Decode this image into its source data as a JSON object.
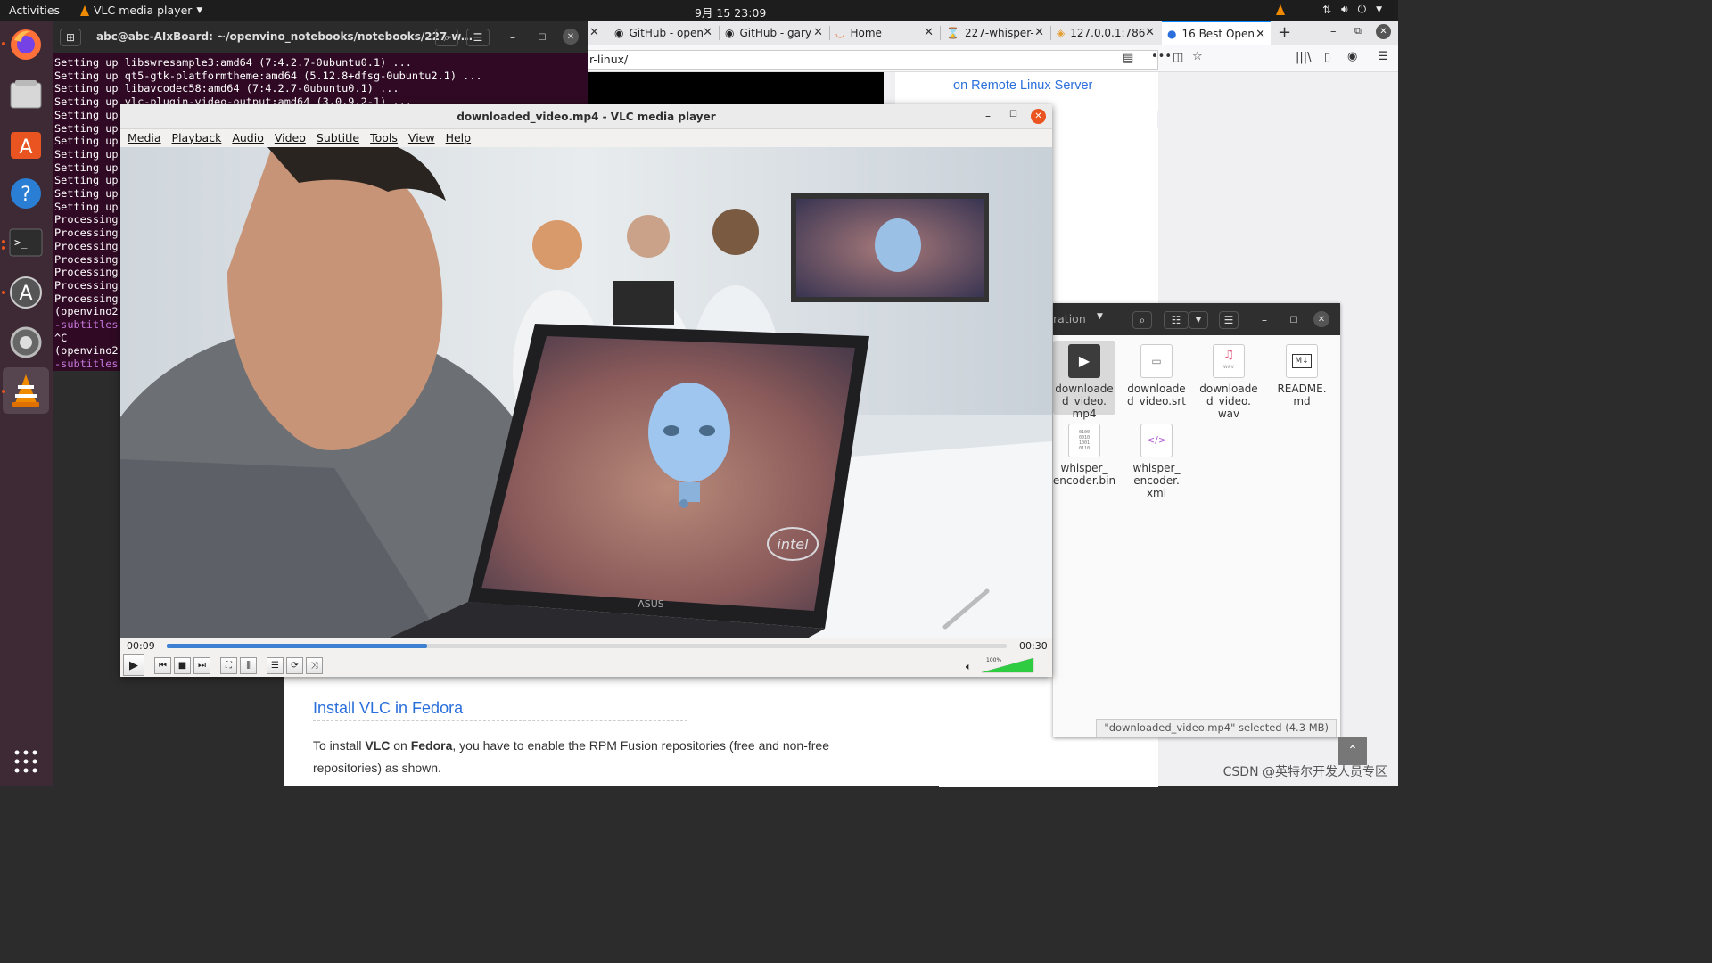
{
  "topbar": {
    "activities": "Activities",
    "app_name": "VLC media player",
    "clock": "9月 15  23:09"
  },
  "dock": {
    "items": [
      "firefox-icon",
      "files-icon",
      "software-center-icon",
      "help-icon",
      "terminal-icon",
      "software-updater-icon",
      "settings-icon",
      "vlc-icon"
    ],
    "grid_label": "show-applications-icon"
  },
  "terminal": {
    "title": "abc@abc-AIxBoard: ~/openvino_notebooks/notebooks/227-w...",
    "lines": [
      "Setting up libswresample3:amd64 (7:4.2.7-0ubuntu0.1) ...",
      "Setting up qt5-gtk-platformtheme:amd64 (5.12.8+dfsg-0ubuntu2.1) ...",
      "Setting up libavcodec58:amd64 (7:4.2.7-0ubuntu0.1) ...",
      "Setting up vlc-plugin-video-output:amd64 (3.0.9.2-1) ...",
      "Setting up",
      "Setting up",
      "Setting up",
      "Setting up",
      "Setting up",
      "Setting up",
      "Setting up",
      "Setting up",
      "Processing",
      "Processing",
      "Processing",
      "Processing",
      "Processing",
      "Processing",
      "Processing",
      "(openvino2",
      "-subtitles",
      "^C",
      "(openvino2",
      "-subtitles"
    ]
  },
  "browser": {
    "tabs": [
      {
        "label": "GitHub - open"
      },
      {
        "label": "GitHub - gary"
      },
      {
        "label": "Home"
      },
      {
        "label": "227-whisper-"
      },
      {
        "label": "127.0.0.1:786"
      },
      {
        "label": "16 Best Open"
      }
    ],
    "url": "r-linux/",
    "sidebar_link": "on Remote Linux Server",
    "heading": "Install VLC in Fedora",
    "para_1a": "To install ",
    "para_1b": "VLC",
    "para_1c": " on ",
    "para_1d": "Fedora",
    "para_1e": ", you have to enable the RPM Fusion repositories (free and non-free",
    "para_2": "repositories) as shown."
  },
  "files": {
    "path_label": "ration",
    "items": [
      {
        "name": "downloaded_video.mp4",
        "label": "downloade\nd_video.\nmp4",
        "icon": "video-file-icon"
      },
      {
        "name": "downloaded_video.srt",
        "label": "downloade\nd_video.srt",
        "icon": "subtitle-file-icon"
      },
      {
        "name": "downloaded_video.wav",
        "label": "downloade\nd_video.\nwav",
        "icon": "audio-file-icon"
      },
      {
        "name": "README.md",
        "label": "README.\nmd",
        "icon": "markdown-file-icon"
      },
      {
        "name": "whisper_encoder.bin",
        "label": "whisper_\nencoder.bin",
        "icon": "binary-file-icon"
      },
      {
        "name": "whisper_encoder.xml",
        "label": "whisper_\nencoder.\nxml",
        "icon": "xml-file-icon"
      }
    ],
    "wav_tag": "wav",
    "bin_tag": "0100\n0010\n1001\n0110",
    "status": "\"downloaded_video.mp4\" selected (4.3 MB)"
  },
  "vlc": {
    "title": "downloaded_video.mp4 - VLC media player",
    "menu": [
      "Media",
      "Playback",
      "Audio",
      "Video",
      "Subtitle",
      "Tools",
      "View",
      "Help"
    ],
    "time_elapsed": "00:09",
    "time_total": "00:30",
    "progress_fraction": 0.31,
    "volume_label": "100%",
    "volume_fraction": 1.0,
    "intel_logo": "intel",
    "laptop_brand": "ASUS"
  },
  "watermark": "CSDN @英特尔开发人员专区",
  "colors": {
    "terminal_bg": "#300a24",
    "vlc_progress": "#3d7fd0",
    "volume_green": "#2ecc40",
    "ubuntu_orange": "#e95420",
    "link_blue": "#2a6fdb"
  }
}
